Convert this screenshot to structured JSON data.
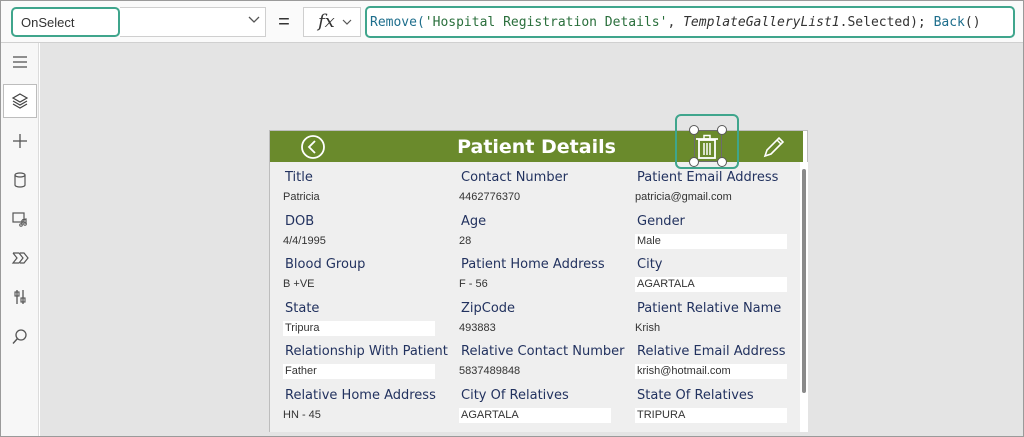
{
  "formula_bar": {
    "property": "OnSelect",
    "equals": "=",
    "fx": "fx",
    "formula_tokens": [
      {
        "text": "Remove(",
        "type": "fn"
      },
      {
        "text": "'Hospital Registration Details'",
        "type": "str"
      },
      {
        "text": ", ",
        "type": "plain"
      },
      {
        "text": "TemplateGalleryList1",
        "type": "ctrl"
      },
      {
        "text": ".Selected); ",
        "type": "plain"
      },
      {
        "text": "Back",
        "type": "fn"
      },
      {
        "text": "()",
        "type": "plain"
      }
    ]
  },
  "left_rail": {
    "items": [
      "hamburger-menu-icon",
      "layers-icon",
      "plus-icon",
      "database-icon",
      "media-icon",
      "power-automate-icon",
      "tools-icon",
      "search-icon"
    ]
  },
  "app": {
    "title": "Patient Details",
    "header_color": "#6a8a2c",
    "back_icon": "back-arrow-circle-icon",
    "delete_icon": "trash-icon",
    "edit_icon": "pencil-icon",
    "fields": [
      {
        "label": "Title",
        "value": "Patricia",
        "boxed": false
      },
      {
        "label": "Contact Number",
        "value": "4462776370",
        "boxed": false
      },
      {
        "label": "Patient Email Address",
        "value": "patricia@gmail.com",
        "boxed": false
      },
      {
        "label": "DOB",
        "value": "4/4/1995",
        "boxed": false
      },
      {
        "label": "Age",
        "value": "28",
        "boxed": false
      },
      {
        "label": "Gender",
        "value": "Male",
        "boxed": true
      },
      {
        "label": "Blood Group",
        "value": "B +VE",
        "boxed": false
      },
      {
        "label": "Patient Home Address",
        "value": "F - 56",
        "boxed": false
      },
      {
        "label": "City",
        "value": "AGARTALA",
        "boxed": true
      },
      {
        "label": "State",
        "value": "Tripura",
        "boxed": true
      },
      {
        "label": "ZipCode",
        "value": "493883",
        "boxed": false
      },
      {
        "label": "Patient Relative Name",
        "value": "Krish",
        "boxed": false
      },
      {
        "label": "Relationship With Patient",
        "value": "Father",
        "boxed": true
      },
      {
        "label": "Relative Contact Number",
        "value": "5837489848",
        "boxed": false
      },
      {
        "label": "Relative Email Address",
        "value": "krish@hotmail.com",
        "boxed": true
      },
      {
        "label": "Relative Home Address",
        "value": "HN - 45",
        "boxed": false
      },
      {
        "label": "City Of Relatives",
        "value": "AGARTALA",
        "boxed": true
      },
      {
        "label": "State Of Relatives",
        "value": "TRIPURA",
        "boxed": true
      }
    ]
  },
  "colors": {
    "accent": "#3fa58c",
    "label": "#22325f"
  }
}
